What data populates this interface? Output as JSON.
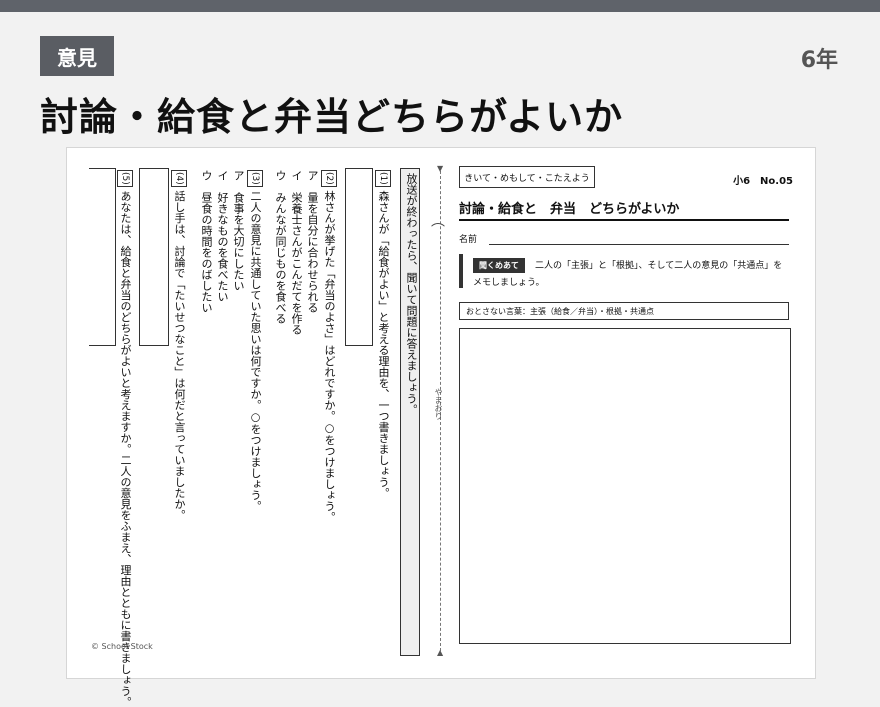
{
  "header": {
    "category": "意見",
    "grade": "6年",
    "title": "討論・給食と弁当どちらがよいか"
  },
  "sheet": {
    "copyright": "© School Stock",
    "instruction": "放送が終わったら、聞いて問題に答えましょう。",
    "fold_label": "やまおり",
    "q1": {
      "num": "(1)",
      "text": "森さんが「給食がよい」と考える理由を、一つ書きましょう。"
    },
    "q2": {
      "num": "(2)",
      "text": "林さんが挙げた「弁当のよさ」はどれですか。○をつけましょう。",
      "options": [
        "ア　量を自分に合わせられる",
        "イ　栄養士さんがこんだてを作る",
        "ウ　みんなが同じものを食べる"
      ]
    },
    "q3": {
      "num": "(3)",
      "text": "二人の意見に共通していた思いは何ですか。○をつけましょう。",
      "options": [
        "ア　食事を大切にしたい",
        "イ　好きなものを食べたい",
        "ウ　昼食の時間をのばしたい"
      ]
    },
    "q4": {
      "num": "(4)",
      "text": "話し手は、討論で「たいせつなこと」は何だと言っていましたか。"
    },
    "q5": {
      "num": "(5)",
      "text": "あなたは、給食と弁当のどちらがよいと考えますか。二人の意見をふまえ、理由とともに書きましょう。"
    },
    "right": {
      "header_box": "きいて・めもして・こたえよう",
      "number": "小6　No.05",
      "title": "討論・給食と　弁当　どちらがよいか",
      "name_label": "名前",
      "task_label": "聞くめあて",
      "task_line1": "二人の「主張」と「根拠」、そして二人の意見の「共通点」を",
      "task_line2": "メモしましょう。",
      "words": "おとさない言葉：主張（給食／弁当）・根拠・共通点"
    }
  }
}
